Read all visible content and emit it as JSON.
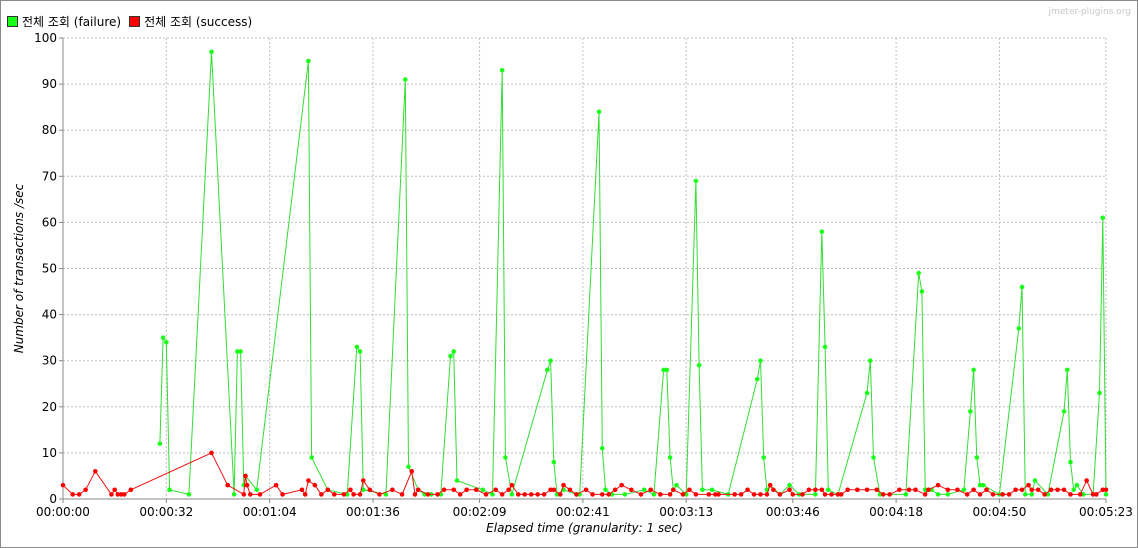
{
  "watermark": "jmeter-plugins.org",
  "chart_data": {
    "type": "line",
    "xlabel": "Elapsed time (granularity: 1 sec)",
    "ylabel": "Number of transactions /sec",
    "xlim": [
      0,
      323
    ],
    "ylim": [
      0,
      100
    ],
    "grid": true,
    "legend_position": "top-left",
    "x_ticks": [
      {
        "t": 0,
        "label": "00:00:00"
      },
      {
        "t": 32,
        "label": "00:00:32"
      },
      {
        "t": 64,
        "label": "00:01:04"
      },
      {
        "t": 96,
        "label": "00:01:36"
      },
      {
        "t": 129,
        "label": "00:02:09"
      },
      {
        "t": 161,
        "label": "00:02:41"
      },
      {
        "t": 193,
        "label": "00:03:13"
      },
      {
        "t": 226,
        "label": "00:03:46"
      },
      {
        "t": 258,
        "label": "00:04:18"
      },
      {
        "t": 290,
        "label": "00:04:50"
      },
      {
        "t": 323,
        "label": "00:05:23"
      }
    ],
    "y_ticks": [
      0,
      10,
      20,
      30,
      40,
      50,
      60,
      70,
      80,
      90,
      100
    ],
    "series": [
      {
        "name": "전체 조회 (failure)",
        "color": "#1aff1a",
        "line_color": "#33dd33",
        "points": [
          [
            30,
            12
          ],
          [
            31,
            35
          ],
          [
            32,
            34
          ],
          [
            33,
            2
          ],
          [
            39,
            1
          ],
          [
            46,
            97
          ],
          [
            53,
            1
          ],
          [
            54,
            32
          ],
          [
            55,
            32
          ],
          [
            56,
            3
          ],
          [
            56.5,
            5
          ],
          [
            60,
            2
          ],
          [
            76,
            95
          ],
          [
            77,
            9
          ],
          [
            82,
            2
          ],
          [
            88,
            1
          ],
          [
            91,
            33
          ],
          [
            92,
            32
          ],
          [
            93,
            2
          ],
          [
            100,
            1
          ],
          [
            106,
            91
          ],
          [
            107,
            7
          ],
          [
            110,
            2
          ],
          [
            112,
            1
          ],
          [
            114,
            1
          ],
          [
            117,
            1
          ],
          [
            120,
            31
          ],
          [
            121,
            32
          ],
          [
            122,
            4
          ],
          [
            130,
            2
          ],
          [
            133,
            1
          ],
          [
            136,
            93
          ],
          [
            137,
            9
          ],
          [
            139,
            1
          ],
          [
            150,
            28
          ],
          [
            151,
            30
          ],
          [
            152,
            8
          ],
          [
            153,
            1
          ],
          [
            155,
            2
          ],
          [
            159,
            1
          ],
          [
            160,
            1
          ],
          [
            166,
            84
          ],
          [
            167,
            11
          ],
          [
            168,
            2
          ],
          [
            170,
            1
          ],
          [
            174,
            1
          ],
          [
            180,
            2
          ],
          [
            183,
            1
          ],
          [
            186,
            28
          ],
          [
            187,
            28
          ],
          [
            188,
            9
          ],
          [
            189,
            2
          ],
          [
            190,
            3
          ],
          [
            193,
            1
          ],
          [
            196,
            69
          ],
          [
            197,
            29
          ],
          [
            198,
            2
          ],
          [
            201,
            2
          ],
          [
            206,
            1
          ],
          [
            215,
            26
          ],
          [
            216,
            30
          ],
          [
            217,
            9
          ],
          [
            218,
            2
          ],
          [
            219,
            3
          ],
          [
            222,
            1
          ],
          [
            225,
            3
          ],
          [
            228,
            1
          ],
          [
            233,
            1
          ],
          [
            235,
            58
          ],
          [
            236,
            33
          ],
          [
            237,
            2
          ],
          [
            240,
            1
          ],
          [
            249,
            23
          ],
          [
            250,
            30
          ],
          [
            251,
            9
          ],
          [
            253,
            1
          ],
          [
            261,
            1
          ],
          [
            265,
            49
          ],
          [
            266,
            45
          ],
          [
            267,
            2
          ],
          [
            269,
            2
          ],
          [
            271,
            1
          ],
          [
            274,
            1
          ],
          [
            279,
            2
          ],
          [
            281,
            19
          ],
          [
            282,
            28
          ],
          [
            283,
            9
          ],
          [
            284,
            3
          ],
          [
            285,
            3
          ],
          [
            290,
            1
          ],
          [
            296,
            37
          ],
          [
            297,
            46
          ],
          [
            298,
            1
          ],
          [
            300,
            1
          ],
          [
            301,
            4
          ],
          [
            305,
            1
          ],
          [
            310,
            19
          ],
          [
            311,
            28
          ],
          [
            312,
            8
          ],
          [
            313,
            2
          ],
          [
            314,
            3
          ],
          [
            316,
            1
          ],
          [
            319,
            1
          ],
          [
            321,
            23
          ],
          [
            322,
            61
          ],
          [
            323,
            1
          ]
        ]
      },
      {
        "name": "전체 조회 (success)",
        "color": "#ff0000",
        "line_color": "#ee1111",
        "points": [
          [
            0,
            3
          ],
          [
            3,
            1
          ],
          [
            5,
            1
          ],
          [
            7,
            2
          ],
          [
            10,
            6
          ],
          [
            15,
            1
          ],
          [
            16,
            2
          ],
          [
            17,
            1
          ],
          [
            18,
            1
          ],
          [
            19,
            1
          ],
          [
            21,
            2
          ],
          [
            46,
            10
          ],
          [
            51,
            3
          ],
          [
            56,
            1
          ],
          [
            56.5,
            5
          ],
          [
            57,
            3
          ],
          [
            58,
            1
          ],
          [
            61,
            1
          ],
          [
            66,
            3
          ],
          [
            68,
            1
          ],
          [
            74,
            2
          ],
          [
            75,
            1
          ],
          [
            76,
            4
          ],
          [
            78,
            3
          ],
          [
            80,
            1
          ],
          [
            82,
            2
          ],
          [
            84,
            1
          ],
          [
            87,
            1
          ],
          [
            89,
            2
          ],
          [
            90,
            1
          ],
          [
            92,
            1
          ],
          [
            93,
            4
          ],
          [
            95,
            2
          ],
          [
            98,
            1
          ],
          [
            102,
            2
          ],
          [
            105,
            1
          ],
          [
            108,
            6
          ],
          [
            109,
            1
          ],
          [
            110,
            2
          ],
          [
            113,
            1
          ],
          [
            116,
            1
          ],
          [
            118,
            2
          ],
          [
            121,
            2
          ],
          [
            123,
            1
          ],
          [
            125,
            2
          ],
          [
            128,
            2
          ],
          [
            131,
            1
          ],
          [
            134,
            2
          ],
          [
            136,
            1
          ],
          [
            138,
            2
          ],
          [
            139,
            3
          ],
          [
            141,
            1
          ],
          [
            143,
            1
          ],
          [
            145,
            1
          ],
          [
            147,
            1
          ],
          [
            149,
            1
          ],
          [
            151,
            2
          ],
          [
            152,
            2
          ],
          [
            154,
            1
          ],
          [
            155,
            3
          ],
          [
            157,
            2
          ],
          [
            159,
            1
          ],
          [
            162,
            2
          ],
          [
            164,
            1
          ],
          [
            167,
            1
          ],
          [
            169,
            1
          ],
          [
            171,
            2
          ],
          [
            173,
            3
          ],
          [
            176,
            2
          ],
          [
            179,
            1
          ],
          [
            182,
            2
          ],
          [
            185,
            1
          ],
          [
            188,
            1
          ],
          [
            189,
            2
          ],
          [
            192,
            1
          ],
          [
            194,
            2
          ],
          [
            196,
            1
          ],
          [
            200,
            1
          ],
          [
            202,
            1
          ],
          [
            203,
            1
          ],
          [
            208,
            1
          ],
          [
            210,
            1
          ],
          [
            212,
            2
          ],
          [
            214,
            1
          ],
          [
            216,
            1
          ],
          [
            218,
            1
          ],
          [
            219,
            3
          ],
          [
            220,
            2
          ],
          [
            222,
            1
          ],
          [
            225,
            2
          ],
          [
            226,
            1
          ],
          [
            229,
            1
          ],
          [
            231,
            2
          ],
          [
            233,
            2
          ],
          [
            235,
            2
          ],
          [
            236,
            1
          ],
          [
            238,
            1
          ],
          [
            240,
            1
          ],
          [
            241,
            1
          ],
          [
            243,
            2
          ],
          [
            246,
            2
          ],
          [
            249,
            2
          ],
          [
            252,
            2
          ],
          [
            254,
            1
          ],
          [
            256,
            1
          ],
          [
            259,
            2
          ],
          [
            262,
            2
          ],
          [
            264,
            2
          ],
          [
            267,
            1
          ],
          [
            268,
            2
          ],
          [
            271,
            3
          ],
          [
            274,
            2
          ],
          [
            277,
            2
          ],
          [
            280,
            1
          ],
          [
            282,
            2
          ],
          [
            284,
            1
          ],
          [
            286,
            2
          ],
          [
            288,
            1
          ],
          [
            291,
            1
          ],
          [
            293,
            1
          ],
          [
            295,
            2
          ],
          [
            297,
            2
          ],
          [
            299,
            3
          ],
          [
            300,
            2
          ],
          [
            302,
            2
          ],
          [
            304,
            1
          ],
          [
            306,
            2
          ],
          [
            308,
            2
          ],
          [
            310,
            2
          ],
          [
            312,
            1
          ],
          [
            315,
            1
          ],
          [
            317,
            4
          ],
          [
            319,
            1
          ],
          [
            320,
            1
          ],
          [
            322,
            2
          ],
          [
            323,
            2
          ]
        ]
      }
    ]
  }
}
